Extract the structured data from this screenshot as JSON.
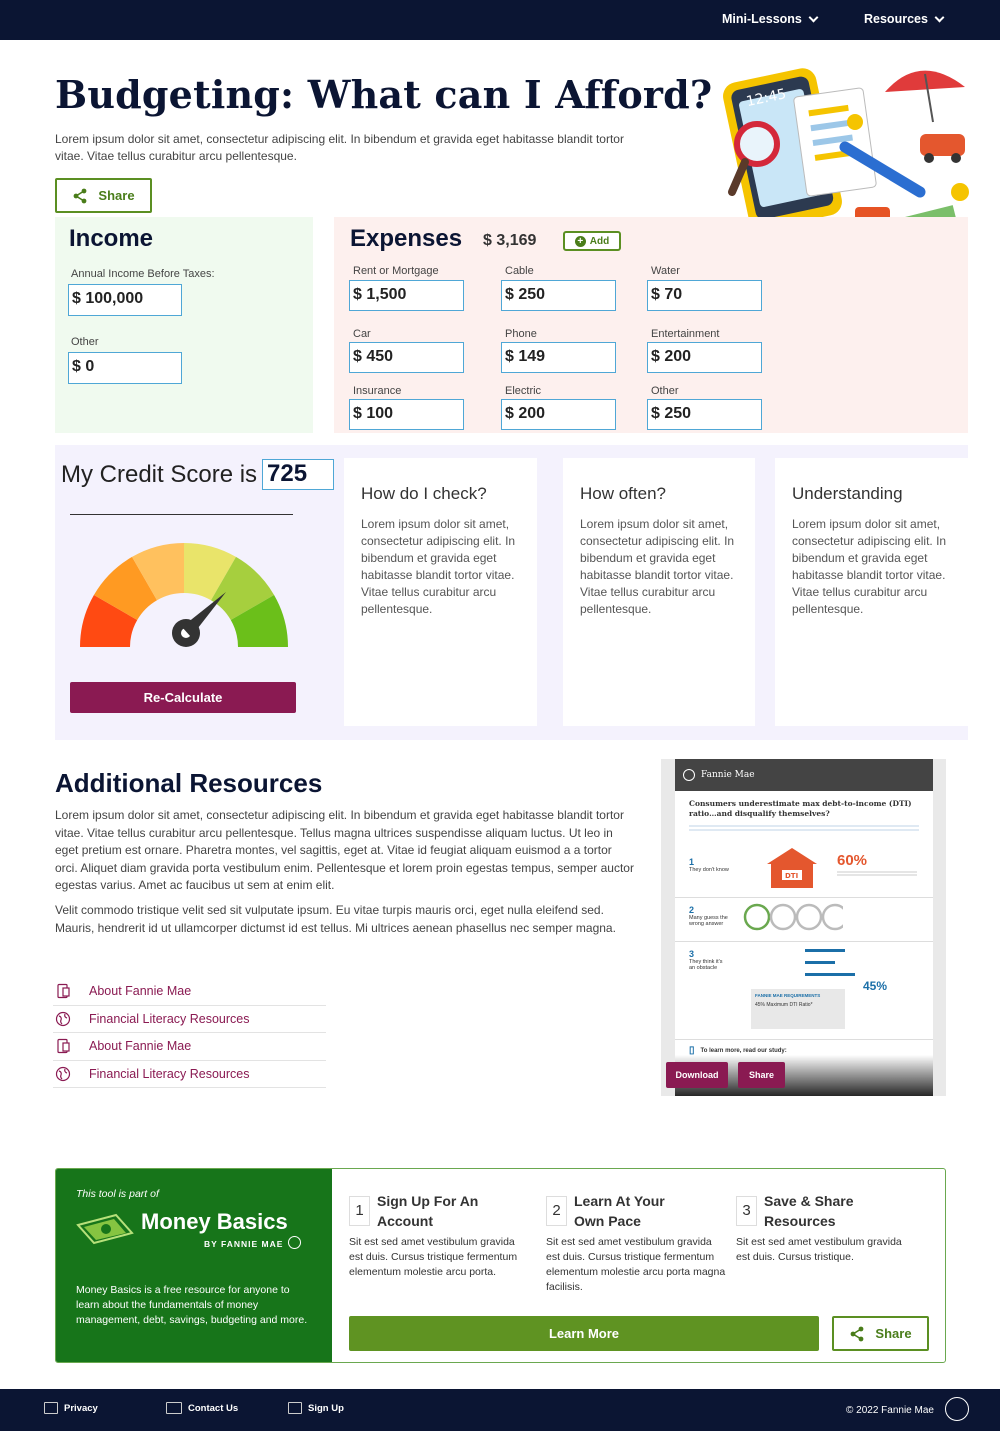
{
  "nav": {
    "items": [
      {
        "label": "Mini-Lessons"
      },
      {
        "label": "Resources"
      }
    ]
  },
  "hero": {
    "title": "Budgeting: What can I Afford?",
    "intro": "Lorem ipsum dolor sit amet, consectetur adipiscing elit. In bibendum et gravida eget habitasse blandit tortor vitae. Vitae tellus curabitur arcu pellentesque.",
    "share_label": "Share"
  },
  "income": {
    "heading": "Income",
    "fields": [
      {
        "label": "Annual Income Before Taxes:",
        "value": "$ 100,000"
      },
      {
        "label": "Other",
        "value": "$ 0"
      }
    ]
  },
  "expenses": {
    "heading": "Expenses",
    "total": "$ 3,169",
    "add_label": "Add",
    "fields": [
      {
        "label": "Rent or Mortgage",
        "value": "$ 1,500"
      },
      {
        "label": "Cable",
        "value": "$ 250"
      },
      {
        "label": "Water",
        "value": "$ 70"
      },
      {
        "label": "Car",
        "value": "$ 450"
      },
      {
        "label": "Phone",
        "value": "$ 149"
      },
      {
        "label": "Entertainment",
        "value": "$ 200"
      },
      {
        "label": "Insurance",
        "value": "$ 100"
      },
      {
        "label": "Electric",
        "value": "$ 200"
      },
      {
        "label": "Other",
        "value": "$ 250"
      }
    ]
  },
  "credit": {
    "title": "My Credit Score is",
    "score": "725",
    "recalculate_label": "Re-Calculate",
    "gauge_colors": [
      "#ff4a12",
      "#ff9a22",
      "#ffc15e",
      "#e9e46a",
      "#a6cf3e",
      "#6bbf1a"
    ],
    "cards": [
      {
        "title": "How do I check?",
        "body": "Lorem ipsum dolor sit amet, consectetur adipiscing elit. In bibendum et gravida eget habitasse blandit tortor vitae. Vitae tellus curabitur arcu pellentesque."
      },
      {
        "title": "How often?",
        "body": "Lorem ipsum dolor sit amet, consectetur adipiscing elit. In bibendum et gravida eget habitasse blandit tortor vitae. Vitae tellus curabitur arcu pellentesque."
      },
      {
        "title": "Understanding",
        "body": "Lorem ipsum dolor sit amet, consectetur adipiscing elit. In bibendum et gravida eget habitasse blandit tortor vitae. Vitae tellus curabitur arcu pellentesque."
      }
    ]
  },
  "resources": {
    "heading": "Additional Resources",
    "p1": "Lorem ipsum dolor sit amet, consectetur adipiscing elit. In bibendum et gravida eget habitasse blandit tortor vitae. Vitae tellus curabitur arcu pellentesque. Tellus magna ultrices suspendisse aliquam luctus. Ut leo in eget pretium est ornare. Pharetra montes, vel sagittis, eget at. Vitae id feugiat aliquam euismod a a tortor orci. Aliquet diam gravida porta vestibulum enim. Pellentesque et lorem proin egestas tempus, semper auctor egestas varius. Amet ac faucibus ut sem at enim elit.",
    "p2": "Velit commodo tristique velit sed sit vulputate ipsum. Eu vitae turpis mauris orci, eget nulla eleifend sed. Mauris, hendrerit id ut ullamcorper dictumst id est tellus. Mi ultrices aenean phasellus nec semper magna.",
    "links": [
      {
        "label": "About Fannie Mae",
        "icon": "document-icon"
      },
      {
        "label": "Financial Literacy Resources",
        "icon": "globe-icon"
      },
      {
        "label": "About Fannie Mae",
        "icon": "document-icon"
      },
      {
        "label": "Financial Literacy Resources",
        "icon": "globe-icon"
      }
    ]
  },
  "infographic": {
    "brand": "Fannie Mae",
    "headline": "Consumers underestimate max debt-to-income (DTI) ratio…and disqualify themselves?",
    "stat1": "60%",
    "stat2": "45%",
    "item1": "They don't know",
    "item2": "Many guess the wrong answer",
    "item3": "They think it's an obstacle",
    "req_title": "FANNIE MAE REQUIREMENTS",
    "req_text": "45% Maximum DTI Ratio*",
    "footer_text": "To learn more, read our study:",
    "download_label": "Download",
    "share_label": "Share"
  },
  "money_basics": {
    "kicker": "This tool is part of",
    "brand": "Money Basics",
    "brand_sub": "BY FANNIE MAE",
    "description": "Money Basics is a free resource for anyone to learn about the fundamentals of money management, debt, savings, budgeting and more.",
    "steps": [
      {
        "num": "1",
        "title": "Sign Up For An Account",
        "body": "Sit est sed amet vestibulum gravida est duis. Cursus tristique fermentum elementum molestie arcu porta."
      },
      {
        "num": "2",
        "title": "Learn At Your Own Pace",
        "body": "Sit est sed amet vestibulum gravida est duis. Cursus tristique fermentum elementum molestie arcu porta magna facilisis."
      },
      {
        "num": "3",
        "title": "Save & Share Resources",
        "body": "Sit est sed amet vestibulum gravida est duis. Cursus tristique."
      }
    ],
    "learn_more_label": "Learn More",
    "share_label": "Share"
  },
  "footer": {
    "links": [
      {
        "label": "Privacy"
      },
      {
        "label": "Contact Us"
      },
      {
        "label": "Sign Up"
      }
    ],
    "copyright": "© 2022 Fannie Mae"
  }
}
